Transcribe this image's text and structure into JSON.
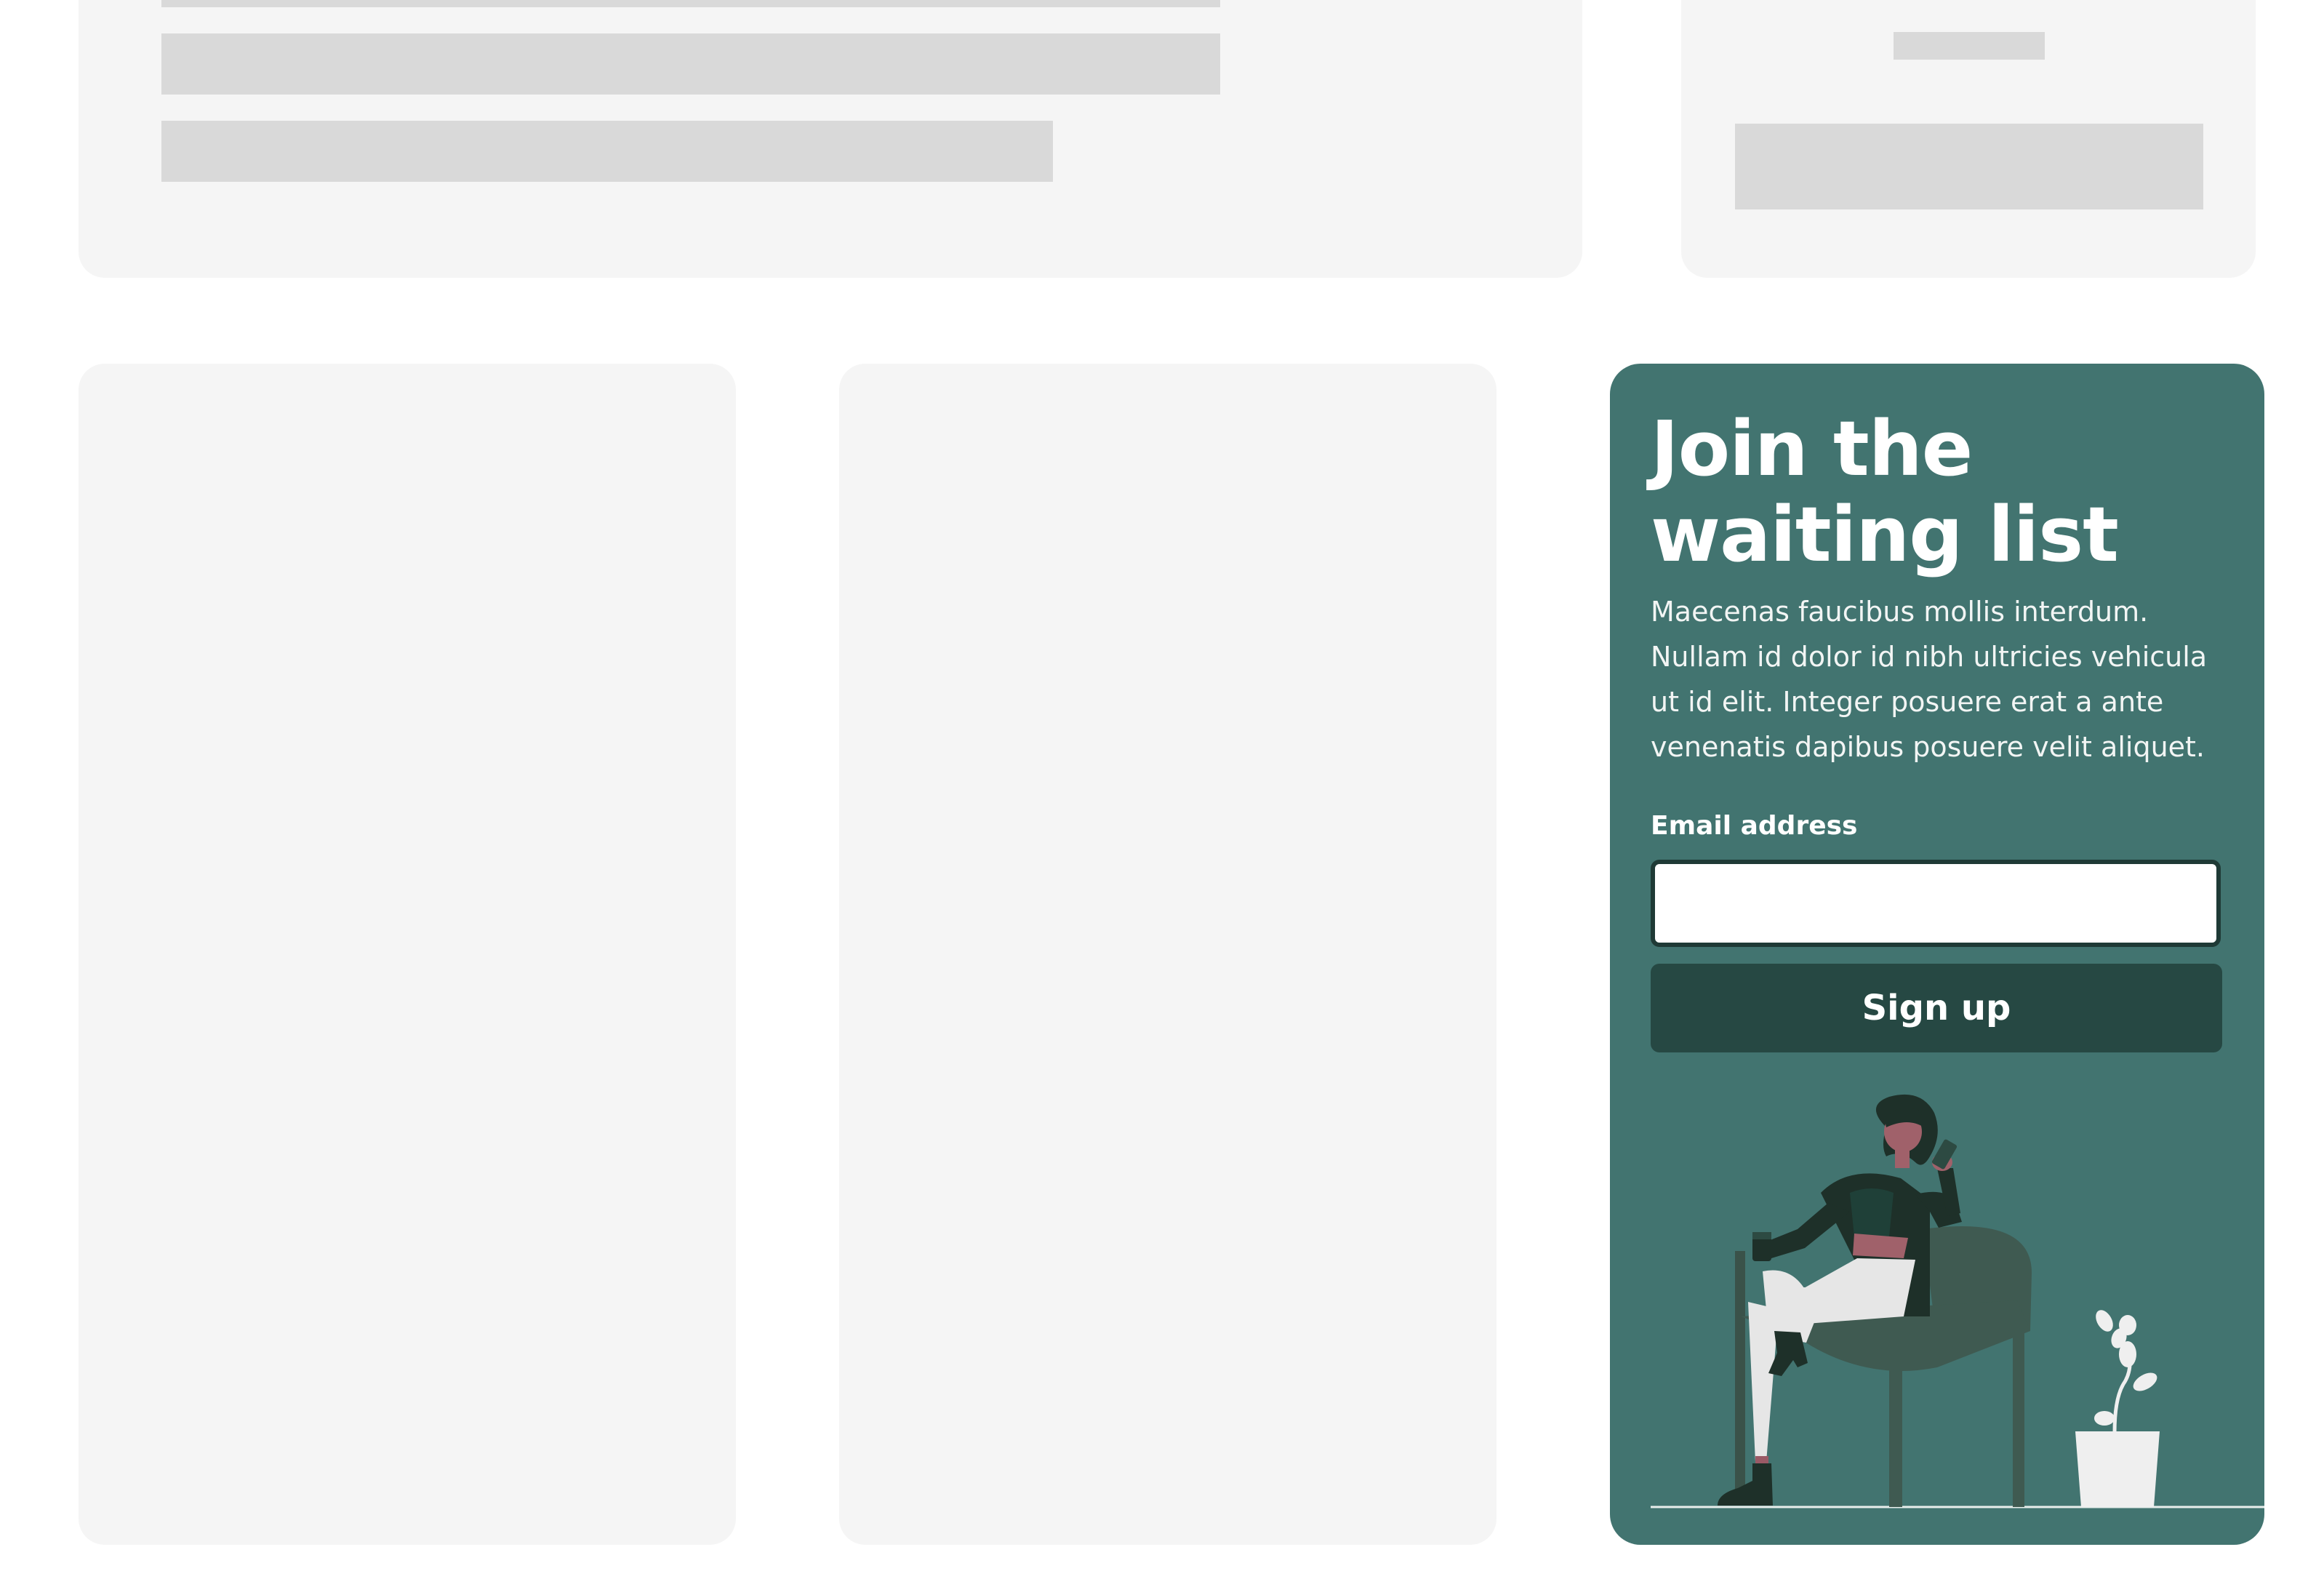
{
  "waitlist": {
    "title": "Join the waiting list",
    "description": "Maecenas faucibus mollis interdum. Nullam id dolor id nibh ultricies vehicula ut id elit. Integer posuere erat a ante venenatis dapibus posuere velit aliquet.",
    "email_label": "Email address",
    "email_value": "",
    "signup_label": "Sign up"
  },
  "colors": {
    "card_background": "#427470",
    "button_background": "#264843",
    "placeholder_card": "#f5f5f5",
    "placeholder_bar": "#d9d9d9"
  },
  "illustration": {
    "icon": "woman-sitting-in-chair-with-phone-illustration"
  }
}
